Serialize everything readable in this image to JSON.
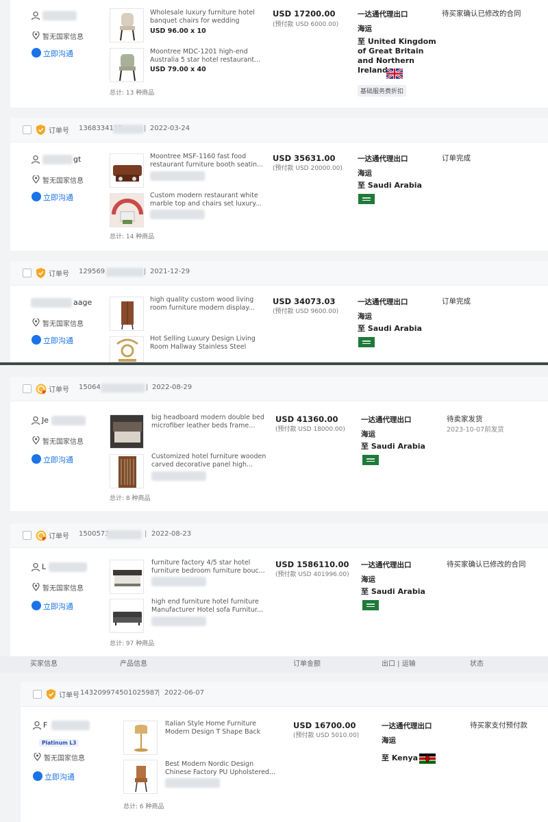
{
  "common": {
    "order_label": "订单号",
    "no_country": "暂无国家信息",
    "chat_now": "立即沟通",
    "logistics_title": "一达通代理出口",
    "logistics_mode": "海运",
    "date_sep": "|"
  },
  "column_headers": [
    "买家信息",
    "产品信息",
    "订单金额",
    "出口 | 运输",
    "状态"
  ],
  "orders": [
    {
      "buyer_name": "",
      "products": [
        {
          "name": "Wholesale luxury furniture hotel banquet chairs for wedding event...",
          "qty": "USD 96.00 x 10"
        },
        {
          "name": "Moontree MDC-1201 high-end Australia 5 star hotel restaurant...",
          "qty": "USD 79.00 x 40"
        }
      ],
      "total": "总计: 13 种商品",
      "amount": "USD 17200.00",
      "prepay": "(预付款 USD 6000.00)",
      "destination": "至 United Kingdom of Great Britain and Northern Ireland",
      "fee_badge": "基础服务费折扣",
      "status": "待买家确认已修改的合同"
    },
    {
      "order_no": "1368334115",
      "date": "2022-03-24",
      "buyer_name": "gt",
      "products": [
        {
          "name": "Moontree MSF-1160 fast food restaurant furniture booth seatin...",
          "qty": ""
        },
        {
          "name": "Custom modern restaurant white marble top and chairs set luxury...",
          "qty": ""
        }
      ],
      "total": "总计: 14 种商品",
      "amount": "USD 35631.00",
      "prepay": "(预付款 USD 20000.00)",
      "destination": "至 Saudi Arabia",
      "status": "订单完成"
    },
    {
      "order_no": "129569",
      "date": "2021-12-29",
      "buyer_name": "aage",
      "products": [
        {
          "name": "high quality custom wood living room furniture modern display...",
          "qty": ""
        },
        {
          "name": "Hot Selling Luxury Design Living Room Hallway Stainless Steel Gol...",
          "qty": ""
        }
      ],
      "amount": "USD 34073.03",
      "prepay": "(预付款 USD 9600.00)",
      "destination": "至 Saudi Arabia",
      "status": "订单完成"
    },
    {
      "order_no": "15064",
      "date": "2022-08-29",
      "buyer_name": "Je",
      "products": [
        {
          "name": "big headboard modern double bed microfiber leather beds frame...",
          "qty": ""
        },
        {
          "name": "Customized hotel furniture wooden carved decorative panel high...",
          "qty": ""
        }
      ],
      "total": "总计: 8 种商品",
      "amount": "USD 41360.00",
      "prepay": "(预付款 USD 18000.00)",
      "destination": "至 Saudi Arabia",
      "status": "待卖家发货",
      "status_sub": "2023-10-07前发货"
    },
    {
      "order_no": "1500573",
      "date": "2022-08-23",
      "buyer_name": "L",
      "products": [
        {
          "name": "furniture factory 4/5 star hotel furniture bedroom furniture bouc...",
          "qty": ""
        },
        {
          "name": "high end furniture hotel furniture Manufacturer Hotel sofa Furnitur...",
          "qty": ""
        }
      ],
      "total": "总计: 97 种商品",
      "amount": "USD 1586110.00",
      "prepay": "(预付款 USD 401996.00)",
      "destination": "至 Saudi Arabia",
      "status": "待买家确认已修改的合同"
    },
    {
      "order_no": "143209974501025987",
      "date": "2022-06-07",
      "buyer_name": "F",
      "buyer_badge": "Platinum L3",
      "products": [
        {
          "name": "Italian Style Home Furniture Modern Design T Shape Back Stoo...",
          "qty": ""
        },
        {
          "name": "Best Modern Nordic Design Chinese Factory PU Upholstered...",
          "qty": ""
        }
      ],
      "total": "总计: 6 种商品",
      "amount": "USD 16700.00",
      "prepay": "(预付款 USD 5010.00)",
      "destination": "至 Kenya",
      "status": "待买家支付预付款"
    }
  ],
  "colors": {
    "link_blue": "#1a73e8",
    "saudi_green": "#1f7a3a",
    "divider": "#3d4a45"
  }
}
